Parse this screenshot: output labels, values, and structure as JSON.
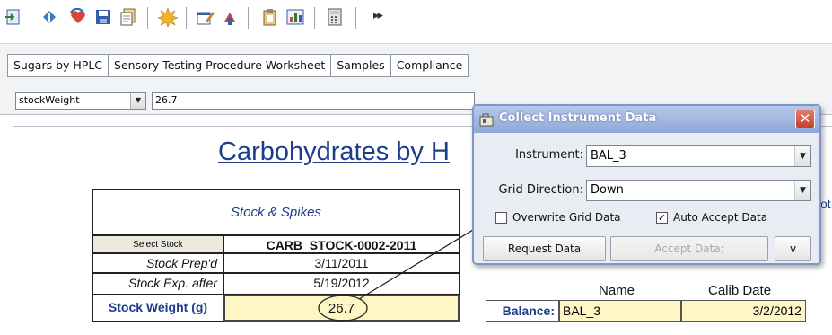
{
  "tabs": [
    {
      "label": "Sugars by HPLC",
      "active": true
    },
    {
      "label": "Sensory Testing Procedure Worksheet",
      "active": false
    },
    {
      "label": "Samples",
      "active": false
    },
    {
      "label": "Compliance",
      "active": false
    }
  ],
  "field_row": {
    "field_name": "stockWeight",
    "field_value": "26.7"
  },
  "report": {
    "title": "Carbohydrates by H",
    "partial_right_text": "ot"
  },
  "stock": {
    "header": "Stock & Spikes",
    "select_label": "Select Stock",
    "select_value": "CARB_STOCK-0002-2011",
    "rows": [
      {
        "label": "Stock Prep'd",
        "value": "3/11/2011"
      },
      {
        "label": "Stock Exp. after",
        "value": "5/19/2012"
      },
      {
        "label": "Stock Weight (g)",
        "value": "26.7"
      }
    ]
  },
  "balance": {
    "name_header": "Name",
    "calib_header": "Calib Date",
    "label": "Balance:",
    "name": "BAL_3",
    "calib_date": "3/2/2012"
  },
  "dialog": {
    "title": "Collect Instrument Data",
    "close_glyph": "✕",
    "instrument_label": "Instrument:",
    "instrument_value": "BAL_3",
    "grid_label": "Grid Direction:",
    "grid_value": "Down",
    "overwrite_label": "Overwrite Grid Data",
    "overwrite_checked": false,
    "auto_accept_label": "Auto Accept Data",
    "auto_accept_checked": true,
    "request_button": "Request Data",
    "accept_button": "Accept Data:",
    "more_button": "v"
  },
  "toolbar": {
    "overflow_glyph": "▸▸"
  },
  "colors": {
    "accent_blue": "#1d3c8a",
    "highlight_yellow": "#fff6c5",
    "dialog_title": "#8ea7d9"
  }
}
